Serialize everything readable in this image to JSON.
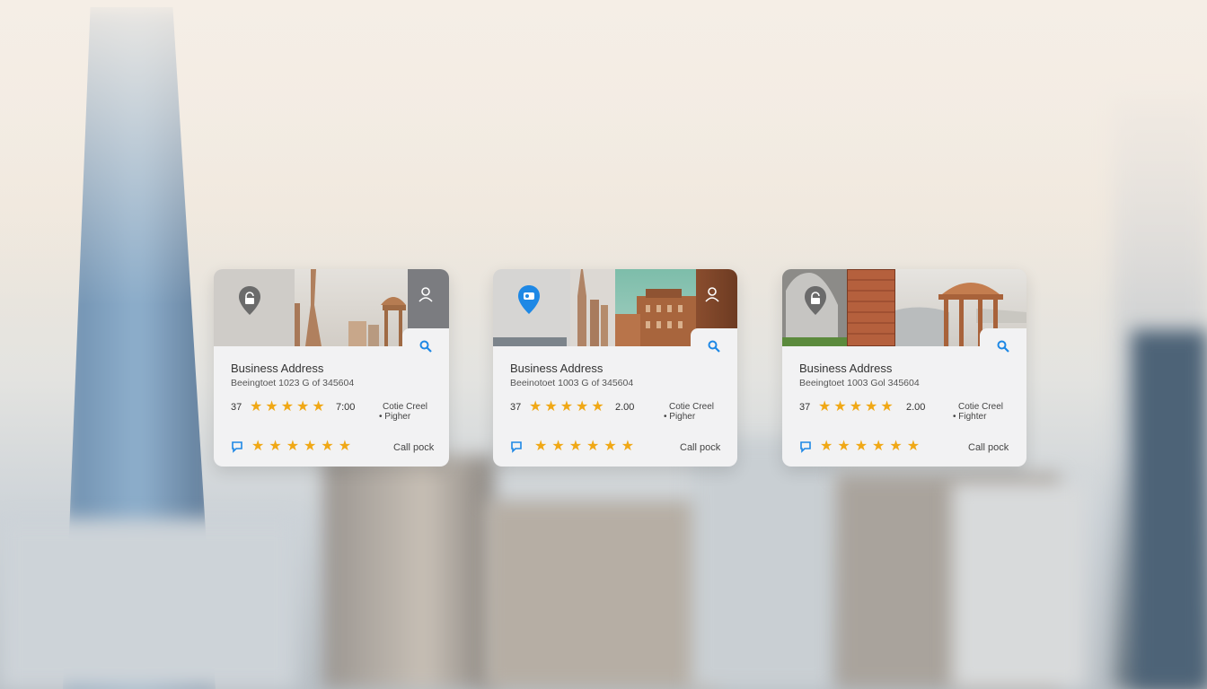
{
  "colors": {
    "accent_blue": "#1e88e5",
    "star": "#f0a816",
    "pin_gray": "#6b6b6b"
  },
  "cards": [
    {
      "pin_icon": "map-pin-icon",
      "title": "Business Address",
      "address": "Beeingtoet 1023 G of 345604",
      "count": "37",
      "rating_value": "7:00",
      "rating": 5,
      "category_line1": "Cotie Creel",
      "category_line2": "• Pigher",
      "second_rating": 6,
      "call_label": "Call pock"
    },
    {
      "pin_icon": "map-pin-icon",
      "title": "Business Address",
      "address": "Beeinotoet 1003 G of 345604",
      "count": "37",
      "rating_value": "2.00",
      "rating": 5,
      "category_line1": "Cotie Creel",
      "category_line2": "• Pigher",
      "second_rating": 6,
      "call_label": "Call pock"
    },
    {
      "pin_icon": "map-pin-icon",
      "title": "Business Address",
      "address": "Beeingtoet 1003 Gol 345604",
      "count": "37",
      "rating_value": "2.00",
      "rating": 5,
      "category_line1": "Cotie Creel",
      "category_line2": "• Fighter",
      "second_rating": 6,
      "call_label": "Call pock"
    }
  ]
}
